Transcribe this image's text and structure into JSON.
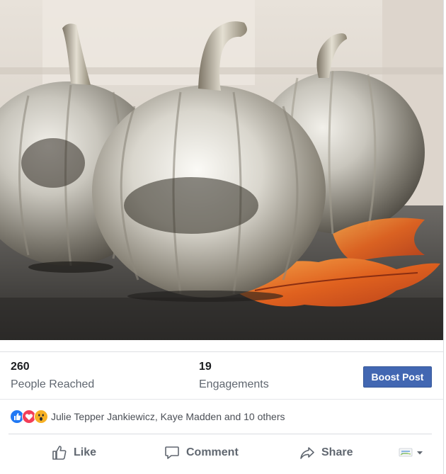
{
  "post": {
    "photo_alt": "",
    "insights": {
      "people_reached": {
        "value": "260",
        "label": "People Reached"
      },
      "engagements": {
        "value": "19",
        "label": "Engagements"
      },
      "boost_label": "Boost Post"
    },
    "reactions": {
      "types": [
        "like-reaction-icon",
        "love-reaction-icon",
        "wow-reaction-icon"
      ],
      "summary": "Julie Tepper Jankiewicz, Kaye Madden and 10 others"
    },
    "actions": {
      "like": "Like",
      "comment": "Comment",
      "share": "Share"
    },
    "colors": {
      "accent": "#4267b2",
      "like": "#2078f4",
      "love": "#f33e58",
      "wow": "#f7b125",
      "muted_text": "#606770"
    }
  }
}
